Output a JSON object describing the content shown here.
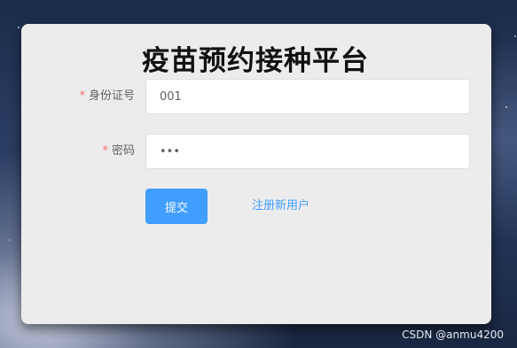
{
  "login": {
    "title": "疫苗预约接种平台",
    "required_mark": "*",
    "id_label": "身份证号",
    "id_value": "001",
    "password_label": "密码",
    "password_value": "123",
    "submit_label": "提交",
    "register_label": "注册新用户"
  },
  "watermark": "CSDN @anmu4200",
  "colors": {
    "primary": "#409eff",
    "required": "#f56c6c",
    "card_background": "#ececec"
  }
}
